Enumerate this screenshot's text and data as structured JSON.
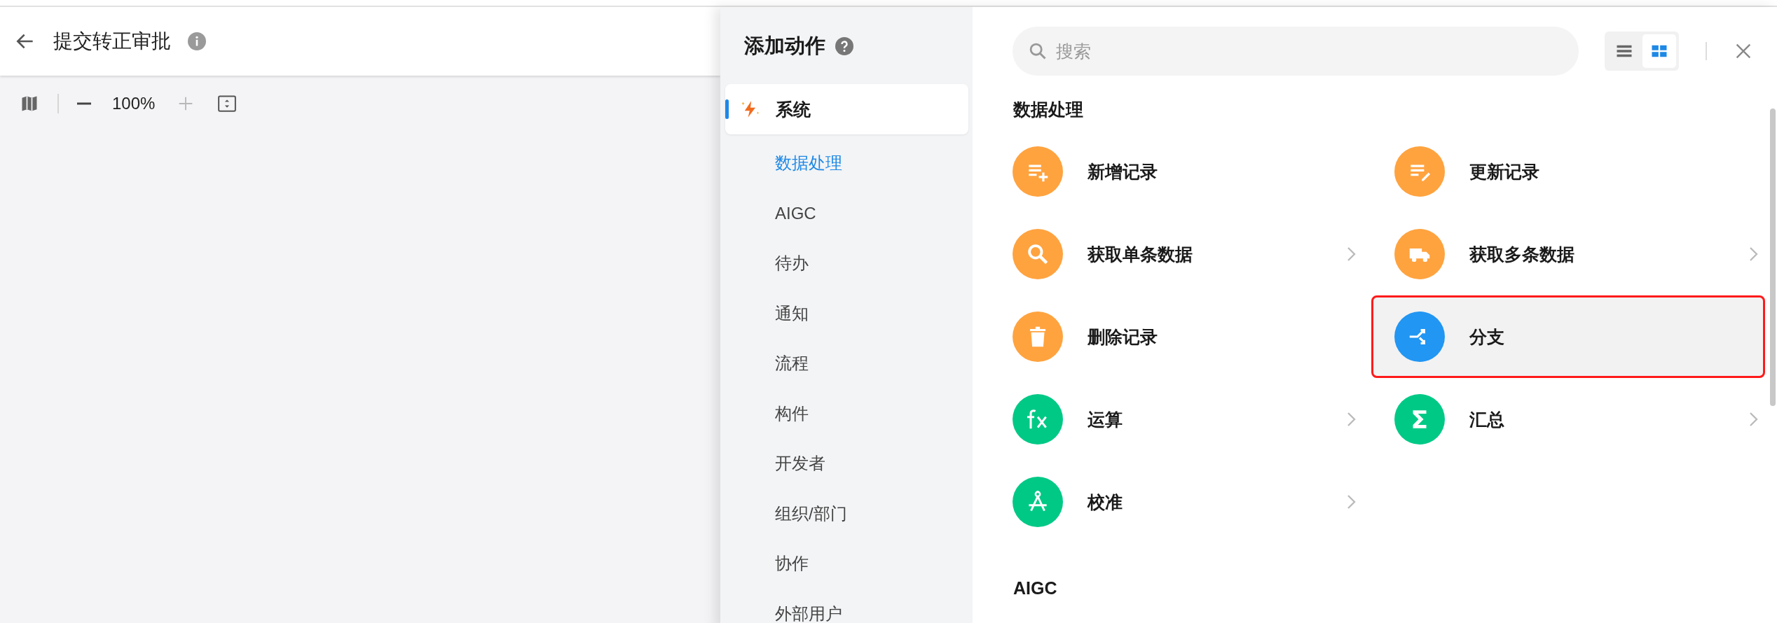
{
  "header": {
    "title": "提交转正审批"
  },
  "canvas_toolbar": {
    "zoom": "100%",
    "zoom_in_disabled": true
  },
  "drawer": {
    "title": "添加动作",
    "sidebar": {
      "groups": [
        {
          "label": "系统",
          "selected": true,
          "children": [
            {
              "label": "数据处理",
              "selected": true
            },
            {
              "label": "AIGC",
              "selected": false
            },
            {
              "label": "待办",
              "selected": false
            },
            {
              "label": "通知",
              "selected": false
            },
            {
              "label": "流程",
              "selected": false
            },
            {
              "label": "构件",
              "selected": false
            },
            {
              "label": "开发者",
              "selected": false
            },
            {
              "label": "组织/部门",
              "selected": false
            },
            {
              "label": "协作",
              "selected": false
            },
            {
              "label": "外部用户",
              "selected": false
            }
          ]
        }
      ]
    },
    "search": {
      "placeholder": "搜索"
    },
    "view_toggle": [
      {
        "kind": "list",
        "selected": false
      },
      {
        "kind": "grid",
        "selected": true
      }
    ],
    "sections": [
      {
        "title": "数据处理",
        "items": [
          {
            "label": "新增记录",
            "kind": "add",
            "color": "#ffa33f",
            "chevron": false,
            "selected": false
          },
          {
            "label": "更新记录",
            "kind": "edit",
            "color": "#ffa33f",
            "chevron": false,
            "selected": false
          },
          {
            "label": "获取单条数据",
            "kind": "search",
            "color": "#ffa33f",
            "chevron": true,
            "selected": false
          },
          {
            "label": "获取多条数据",
            "kind": "truck",
            "color": "#ffa33f",
            "chevron": true,
            "selected": false
          },
          {
            "label": "删除记录",
            "kind": "trash",
            "color": "#ffa33f",
            "chevron": false,
            "selected": false
          },
          {
            "label": "分支",
            "kind": "branch",
            "color": "#2196f3",
            "chevron": false,
            "selected": true
          },
          {
            "label": "运算",
            "kind": "fx",
            "color": "#00c986",
            "chevron": true,
            "selected": false
          },
          {
            "label": "汇总",
            "kind": "sigma",
            "color": "#00c986",
            "chevron": true,
            "selected": false
          },
          {
            "label": "校准",
            "kind": "compass",
            "color": "#00c986",
            "chevron": true,
            "selected": false
          }
        ]
      },
      {
        "title": "AIGC"
      }
    ]
  }
}
